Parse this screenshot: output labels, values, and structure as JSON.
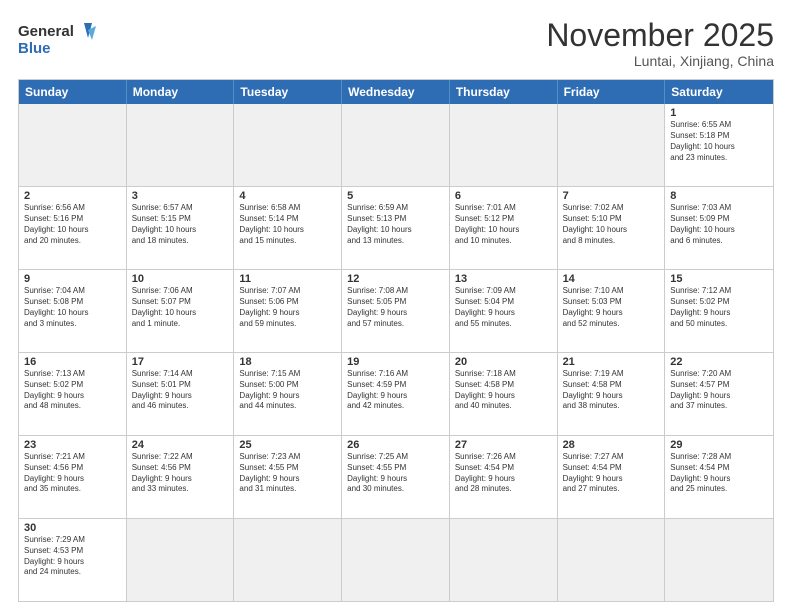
{
  "header": {
    "logo_general": "General",
    "logo_blue": "Blue",
    "month_title": "November 2025",
    "location": "Luntai, Xinjiang, China"
  },
  "days_of_week": [
    "Sunday",
    "Monday",
    "Tuesday",
    "Wednesday",
    "Thursday",
    "Friday",
    "Saturday"
  ],
  "weeks": [
    [
      {
        "day": "",
        "info": "",
        "empty": true
      },
      {
        "day": "",
        "info": "",
        "empty": true
      },
      {
        "day": "",
        "info": "",
        "empty": true
      },
      {
        "day": "",
        "info": "",
        "empty": true
      },
      {
        "day": "",
        "info": "",
        "empty": true
      },
      {
        "day": "",
        "info": "",
        "empty": true
      },
      {
        "day": "1",
        "info": "Sunrise: 6:55 AM\nSunset: 5:18 PM\nDaylight: 10 hours\nand 23 minutes."
      }
    ],
    [
      {
        "day": "2",
        "info": "Sunrise: 6:56 AM\nSunset: 5:16 PM\nDaylight: 10 hours\nand 20 minutes."
      },
      {
        "day": "3",
        "info": "Sunrise: 6:57 AM\nSunset: 5:15 PM\nDaylight: 10 hours\nand 18 minutes."
      },
      {
        "day": "4",
        "info": "Sunrise: 6:58 AM\nSunset: 5:14 PM\nDaylight: 10 hours\nand 15 minutes."
      },
      {
        "day": "5",
        "info": "Sunrise: 6:59 AM\nSunset: 5:13 PM\nDaylight: 10 hours\nand 13 minutes."
      },
      {
        "day": "6",
        "info": "Sunrise: 7:01 AM\nSunset: 5:12 PM\nDaylight: 10 hours\nand 10 minutes."
      },
      {
        "day": "7",
        "info": "Sunrise: 7:02 AM\nSunset: 5:10 PM\nDaylight: 10 hours\nand 8 minutes."
      },
      {
        "day": "8",
        "info": "Sunrise: 7:03 AM\nSunset: 5:09 PM\nDaylight: 10 hours\nand 6 minutes."
      }
    ],
    [
      {
        "day": "9",
        "info": "Sunrise: 7:04 AM\nSunset: 5:08 PM\nDaylight: 10 hours\nand 3 minutes."
      },
      {
        "day": "10",
        "info": "Sunrise: 7:06 AM\nSunset: 5:07 PM\nDaylight: 10 hours\nand 1 minute."
      },
      {
        "day": "11",
        "info": "Sunrise: 7:07 AM\nSunset: 5:06 PM\nDaylight: 9 hours\nand 59 minutes."
      },
      {
        "day": "12",
        "info": "Sunrise: 7:08 AM\nSunset: 5:05 PM\nDaylight: 9 hours\nand 57 minutes."
      },
      {
        "day": "13",
        "info": "Sunrise: 7:09 AM\nSunset: 5:04 PM\nDaylight: 9 hours\nand 55 minutes."
      },
      {
        "day": "14",
        "info": "Sunrise: 7:10 AM\nSunset: 5:03 PM\nDaylight: 9 hours\nand 52 minutes."
      },
      {
        "day": "15",
        "info": "Sunrise: 7:12 AM\nSunset: 5:02 PM\nDaylight: 9 hours\nand 50 minutes."
      }
    ],
    [
      {
        "day": "16",
        "info": "Sunrise: 7:13 AM\nSunset: 5:02 PM\nDaylight: 9 hours\nand 48 minutes."
      },
      {
        "day": "17",
        "info": "Sunrise: 7:14 AM\nSunset: 5:01 PM\nDaylight: 9 hours\nand 46 minutes."
      },
      {
        "day": "18",
        "info": "Sunrise: 7:15 AM\nSunset: 5:00 PM\nDaylight: 9 hours\nand 44 minutes."
      },
      {
        "day": "19",
        "info": "Sunrise: 7:16 AM\nSunset: 4:59 PM\nDaylight: 9 hours\nand 42 minutes."
      },
      {
        "day": "20",
        "info": "Sunrise: 7:18 AM\nSunset: 4:58 PM\nDaylight: 9 hours\nand 40 minutes."
      },
      {
        "day": "21",
        "info": "Sunrise: 7:19 AM\nSunset: 4:58 PM\nDaylight: 9 hours\nand 38 minutes."
      },
      {
        "day": "22",
        "info": "Sunrise: 7:20 AM\nSunset: 4:57 PM\nDaylight: 9 hours\nand 37 minutes."
      }
    ],
    [
      {
        "day": "23",
        "info": "Sunrise: 7:21 AM\nSunset: 4:56 PM\nDaylight: 9 hours\nand 35 minutes."
      },
      {
        "day": "24",
        "info": "Sunrise: 7:22 AM\nSunset: 4:56 PM\nDaylight: 9 hours\nand 33 minutes."
      },
      {
        "day": "25",
        "info": "Sunrise: 7:23 AM\nSunset: 4:55 PM\nDaylight: 9 hours\nand 31 minutes."
      },
      {
        "day": "26",
        "info": "Sunrise: 7:25 AM\nSunset: 4:55 PM\nDaylight: 9 hours\nand 30 minutes."
      },
      {
        "day": "27",
        "info": "Sunrise: 7:26 AM\nSunset: 4:54 PM\nDaylight: 9 hours\nand 28 minutes."
      },
      {
        "day": "28",
        "info": "Sunrise: 7:27 AM\nSunset: 4:54 PM\nDaylight: 9 hours\nand 27 minutes."
      },
      {
        "day": "29",
        "info": "Sunrise: 7:28 AM\nSunset: 4:54 PM\nDaylight: 9 hours\nand 25 minutes."
      }
    ],
    [
      {
        "day": "30",
        "info": "Sunrise: 7:29 AM\nSunset: 4:53 PM\nDaylight: 9 hours\nand 24 minutes."
      },
      {
        "day": "",
        "info": "",
        "empty": true
      },
      {
        "day": "",
        "info": "",
        "empty": true
      },
      {
        "day": "",
        "info": "",
        "empty": true
      },
      {
        "day": "",
        "info": "",
        "empty": true
      },
      {
        "day": "",
        "info": "",
        "empty": true
      },
      {
        "day": "",
        "info": "",
        "empty": true
      }
    ]
  ]
}
